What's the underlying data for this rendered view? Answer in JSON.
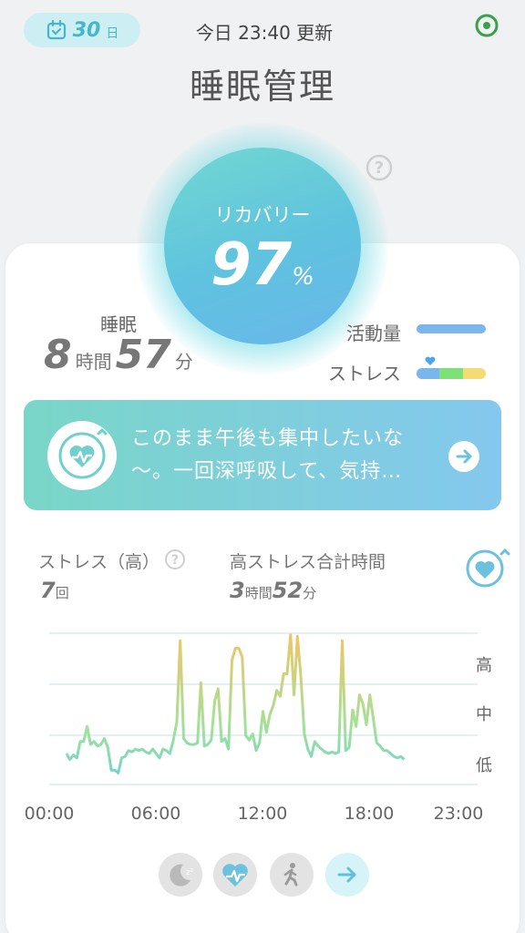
{
  "header": {
    "days_value": "30",
    "days_unit": "日",
    "updated_text": "今日 23:40 更新",
    "title": "睡眠管理"
  },
  "recovery": {
    "label": "リカバリー",
    "value": "97",
    "unit": "%"
  },
  "sleep": {
    "label": "睡眠",
    "hours": "8",
    "hours_unit": "時間",
    "minutes": "57",
    "minutes_unit": "分"
  },
  "legend": {
    "activity": "活動量",
    "stress": "ストレス"
  },
  "banner": {
    "message": "このまま午後も集中したいな～。一回深呼吸して、気持…"
  },
  "stats": {
    "high_stress_label": "ストレス（高）",
    "high_stress_count": "7",
    "high_stress_unit": "回",
    "total_label": "高ストレス合計時間",
    "total_hours": "3",
    "total_hours_unit": "時間",
    "total_minutes": "52",
    "total_minutes_unit": "分"
  },
  "chart_data": {
    "type": "line",
    "x_ticks": [
      "00:00",
      "06:00",
      "12:00",
      "18:00",
      "23:00"
    ],
    "y_levels": [
      "高",
      "中",
      "低"
    ],
    "x_hours": [
      1.0,
      1.2,
      1.4,
      1.6,
      1.8,
      2.0,
      2.2,
      2.4,
      2.6,
      2.8,
      3.0,
      3.2,
      3.4,
      3.6,
      3.8,
      4.0,
      4.2,
      4.4,
      4.6,
      4.8,
      5.0,
      5.2,
      5.4,
      5.6,
      5.8,
      6.0,
      6.2,
      6.4,
      6.6,
      6.8,
      7.0,
      7.2,
      7.4,
      7.6,
      7.8,
      8.0,
      8.2,
      8.4,
      8.6,
      8.8,
      9.0,
      9.2,
      9.4,
      9.6,
      9.8,
      10.0,
      10.2,
      10.4,
      10.6,
      10.8,
      11.0,
      11.2,
      11.4,
      11.6,
      11.8,
      12.0,
      12.2,
      12.4,
      12.6,
      12.8,
      13.0,
      13.2,
      13.4,
      13.6,
      13.8,
      14.0,
      14.2,
      14.4,
      14.6,
      14.8,
      15.0,
      15.2,
      15.4,
      15.6,
      15.8,
      16.0,
      16.2,
      16.4,
      16.6,
      16.8,
      17.0,
      17.2,
      17.4,
      17.6,
      17.8,
      18.0,
      18.2,
      18.4,
      18.6,
      18.8,
      19.0,
      19.2,
      19.4,
      19.6,
      19.8,
      20.0,
      20.2,
      20.4,
      20.6,
      20.8,
      21.0,
      21.2,
      21.4,
      21.6,
      21.8,
      22.0,
      22.2,
      22.4,
      22.6,
      22.8,
      23.0
    ],
    "stress": [
      0.2,
      0.16,
      0.19,
      0.17,
      0.28,
      0.28,
      0.38,
      0.26,
      0.28,
      0.25,
      0.26,
      0.3,
      0.24,
      0.09,
      0.09,
      0.07,
      0.17,
      0.18,
      0.22,
      0.21,
      0.23,
      0.22,
      0.23,
      0.21,
      0.2,
      0.23,
      0.2,
      0.17,
      0.23,
      0.22,
      0.2,
      0.29,
      0.41,
      0.95,
      0.3,
      0.27,
      0.26,
      0.26,
      0.27,
      0.67,
      0.25,
      0.26,
      0.29,
      0.55,
      0.63,
      0.28,
      0.3,
      0.23,
      0.82,
      0.9,
      0.9,
      0.84,
      0.32,
      0.29,
      0.33,
      0.22,
      0.27,
      0.48,
      0.34,
      0.46,
      0.52,
      0.62,
      0.58,
      0.73,
      0.73,
      0.99,
      0.59,
      0.98,
      0.71,
      0.33,
      0.23,
      0.18,
      0.28,
      0.25,
      0.23,
      0.21,
      0.2,
      0.21,
      0.2,
      0.21,
      0.95,
      0.22,
      0.24,
      0.49,
      0.38,
      0.59,
      0.53,
      0.39,
      0.59,
      0.43,
      0.27,
      0.25,
      0.22,
      0.22,
      0.2,
      0.18,
      0.17,
      0.18,
      0.16
    ],
    "ylim": [
      0,
      1
    ]
  },
  "nav": [
    "sleep-icon",
    "heart-monitor-icon",
    "walk-icon",
    "arrow-right-icon"
  ]
}
